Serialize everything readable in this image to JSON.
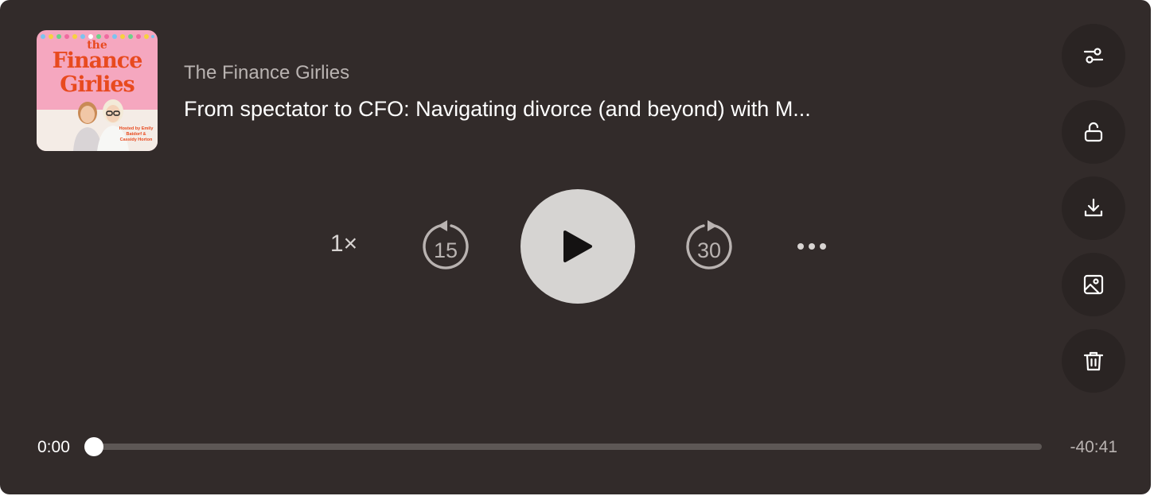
{
  "artwork": {
    "line1": "the",
    "line2": "Finance",
    "line3": "Girlies",
    "hosted_by": "Hosted by Emily Batdorf & Cassidy Horton"
  },
  "podcast": {
    "name": "The Finance Girlies",
    "episode_title": "From spectator to CFO: Navigating divorce (and beyond) with M..."
  },
  "side_actions": [
    {
      "icon": "sliders-icon"
    },
    {
      "icon": "unlock-icon"
    },
    {
      "icon": "download-icon"
    },
    {
      "icon": "image-icon"
    },
    {
      "icon": "trash-icon"
    }
  ],
  "controls": {
    "speed": "1×",
    "skip_back": "15",
    "skip_forward": "30",
    "play_icon": "play-icon",
    "more_icon": "more-icon"
  },
  "progress": {
    "elapsed": "0:00",
    "remaining": "-40:41",
    "fraction": 0.0
  },
  "colors": {
    "background": "#322b2a",
    "accent": "#d6d4d2",
    "brand_artwork": "#e84a1f"
  }
}
